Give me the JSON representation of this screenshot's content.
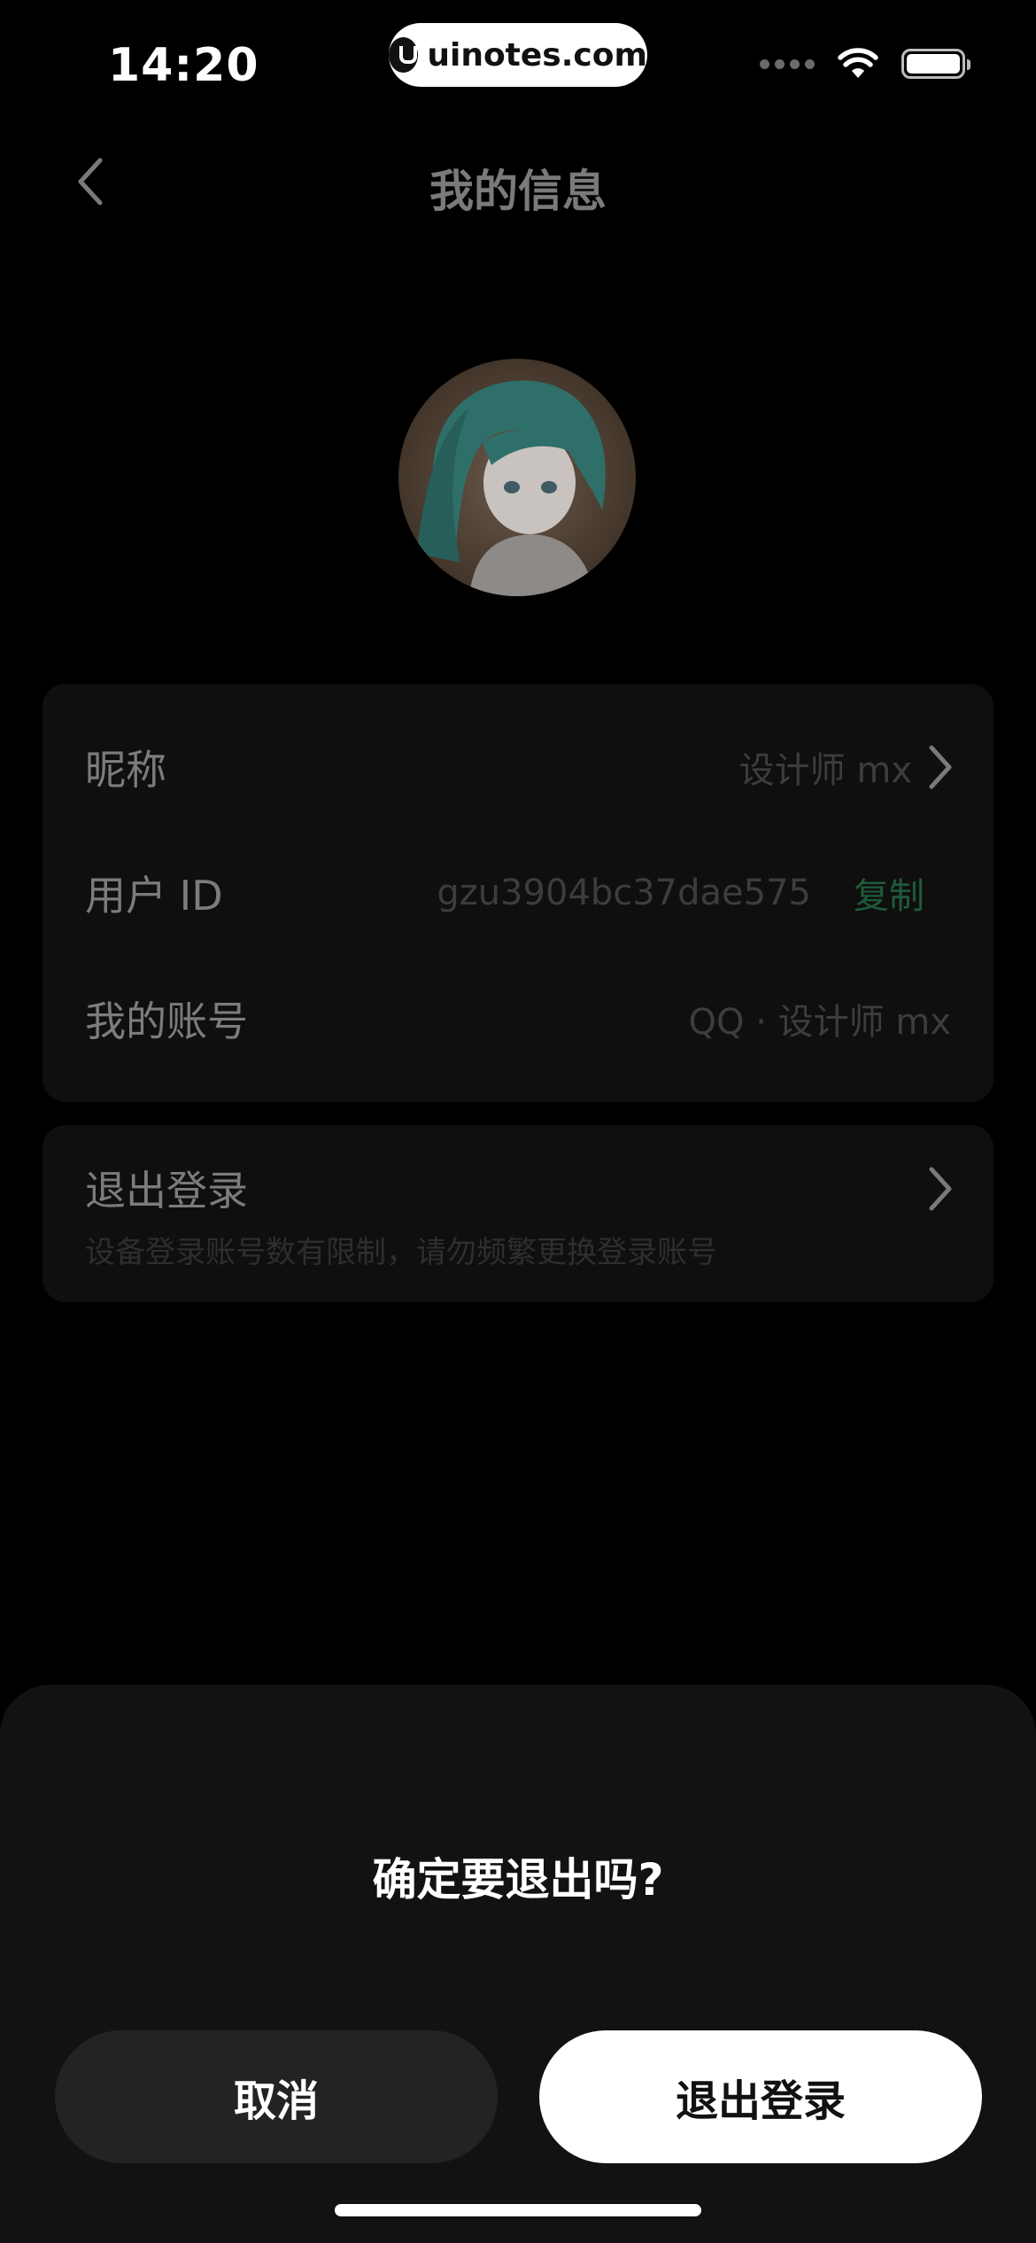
{
  "status_bar": {
    "time": "14:20",
    "watermark": "uinotes.com",
    "icons": [
      "signal-dots-icon",
      "wifi-icon",
      "battery-icon"
    ]
  },
  "header": {
    "title": "我的信息",
    "back_icon": "chevron-left-icon"
  },
  "profile": {
    "avatar": "anime-figure-avatar"
  },
  "info_card": {
    "nickname_label": "昵称",
    "nickname_value": "设计师 mx",
    "user_id_label": "用户 ID",
    "user_id_value": "gzu3904bc37dae575",
    "copy_label": "复制",
    "account_label": "我的账号",
    "account_value": "QQ · 设计师 mx"
  },
  "logout_card": {
    "title": "退出登录",
    "note": "设备登录账号数有限制，请勿频繁更换登录账号"
  },
  "dialog": {
    "title": "确定要退出吗?",
    "cancel_label": "取消",
    "confirm_label": "退出登录"
  },
  "colors": {
    "background": "#000000",
    "sheet": "#121212",
    "card": "#0f0f0f",
    "copy_accent": "#1f5a3a",
    "confirm_button": "#ffffff",
    "cancel_button": "#232323"
  }
}
